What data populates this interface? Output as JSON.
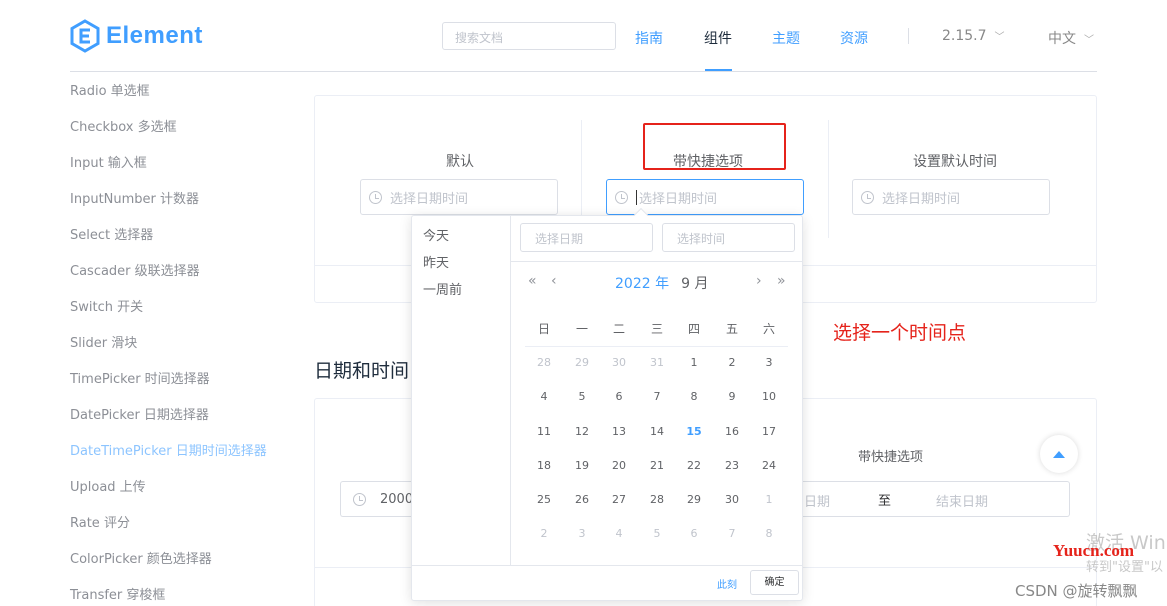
{
  "header": {
    "logo_text": "Element",
    "search_placeholder": "搜索文档",
    "nav": [
      "指南",
      "组件",
      "主题",
      "资源"
    ],
    "version": "2.15.7",
    "language": "中文"
  },
  "sidebar": {
    "items": [
      "Radio 单选框",
      "Checkbox 多选框",
      "Input 输入框",
      "InputNumber 计数器",
      "Select 选择器",
      "Cascader 级联选择器",
      "Switch 开关",
      "Slider 滑块",
      "TimePicker 时间选择器",
      "DatePicker 日期选择器",
      "DateTimePicker 日期时间选择器",
      "Upload 上传",
      "Rate 评分",
      "ColorPicker 颜色选择器",
      "Transfer 穿梭框"
    ],
    "active_index": 10
  },
  "demo1": {
    "labels": [
      "默认",
      "带快捷选项",
      "设置默认时间"
    ],
    "placeholder": "选择日期时间"
  },
  "section2": {
    "title": "日期和时间",
    "label": "带快捷选项",
    "start_value": "2000-",
    "start_placeholder_partial": "日期",
    "separator": "至",
    "end_placeholder": "结束日期"
  },
  "annotation": "选择一个时间点",
  "picker": {
    "shortcuts": [
      "今天",
      "昨天",
      "一周前"
    ],
    "date_placeholder": "选择日期",
    "time_placeholder": "选择时间",
    "year_label": "2022 年",
    "month_label": "9 月",
    "prev_year": "«",
    "prev_month": "‹",
    "next_month": "›",
    "next_year": "»",
    "weekdays": [
      "日",
      "一",
      "二",
      "三",
      "四",
      "五",
      "六"
    ],
    "weeks": [
      [
        "28",
        "29",
        "30",
        "31",
        "1",
        "2",
        "3"
      ],
      [
        "4",
        "5",
        "6",
        "7",
        "8",
        "9",
        "10"
      ],
      [
        "11",
        "12",
        "13",
        "14",
        "15",
        "16",
        "17"
      ],
      [
        "18",
        "19",
        "20",
        "21",
        "22",
        "23",
        "24"
      ],
      [
        "25",
        "26",
        "27",
        "28",
        "29",
        "30",
        "1"
      ],
      [
        "2",
        "3",
        "4",
        "5",
        "6",
        "7",
        "8"
      ]
    ],
    "today": "15",
    "now_label": "此刻",
    "confirm_label": "确定"
  },
  "watermarks": {
    "activate": "激活 Win",
    "settings_hint": "转到\"设置\"以",
    "site": "Yuucn.com",
    "author": "CSDN @旋转飘飘"
  },
  "colors": {
    "primary": "#409eff",
    "annotation": "#e5231b"
  }
}
